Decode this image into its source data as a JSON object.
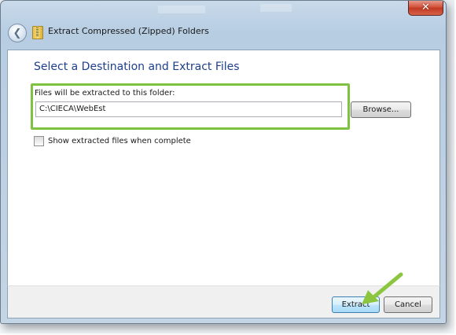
{
  "window": {
    "title": "Extract Compressed (Zipped) Folders",
    "close_glyph": "✕",
    "back_glyph": "❮"
  },
  "main": {
    "heading": "Select a Destination and Extract Files",
    "folder_label": "Files will be extracted to this folder:",
    "folder_path": "C:\\CIECA\\WebEst",
    "browse_label": "Browse...",
    "show_files_label": "Show extracted files when complete",
    "show_files_checked": false
  },
  "footer": {
    "extract_label": "Extract",
    "cancel_label": "Cancel"
  },
  "colors": {
    "highlight": "#7fc242",
    "heading": "#1e3f8c",
    "close_button": "#c23a22"
  }
}
